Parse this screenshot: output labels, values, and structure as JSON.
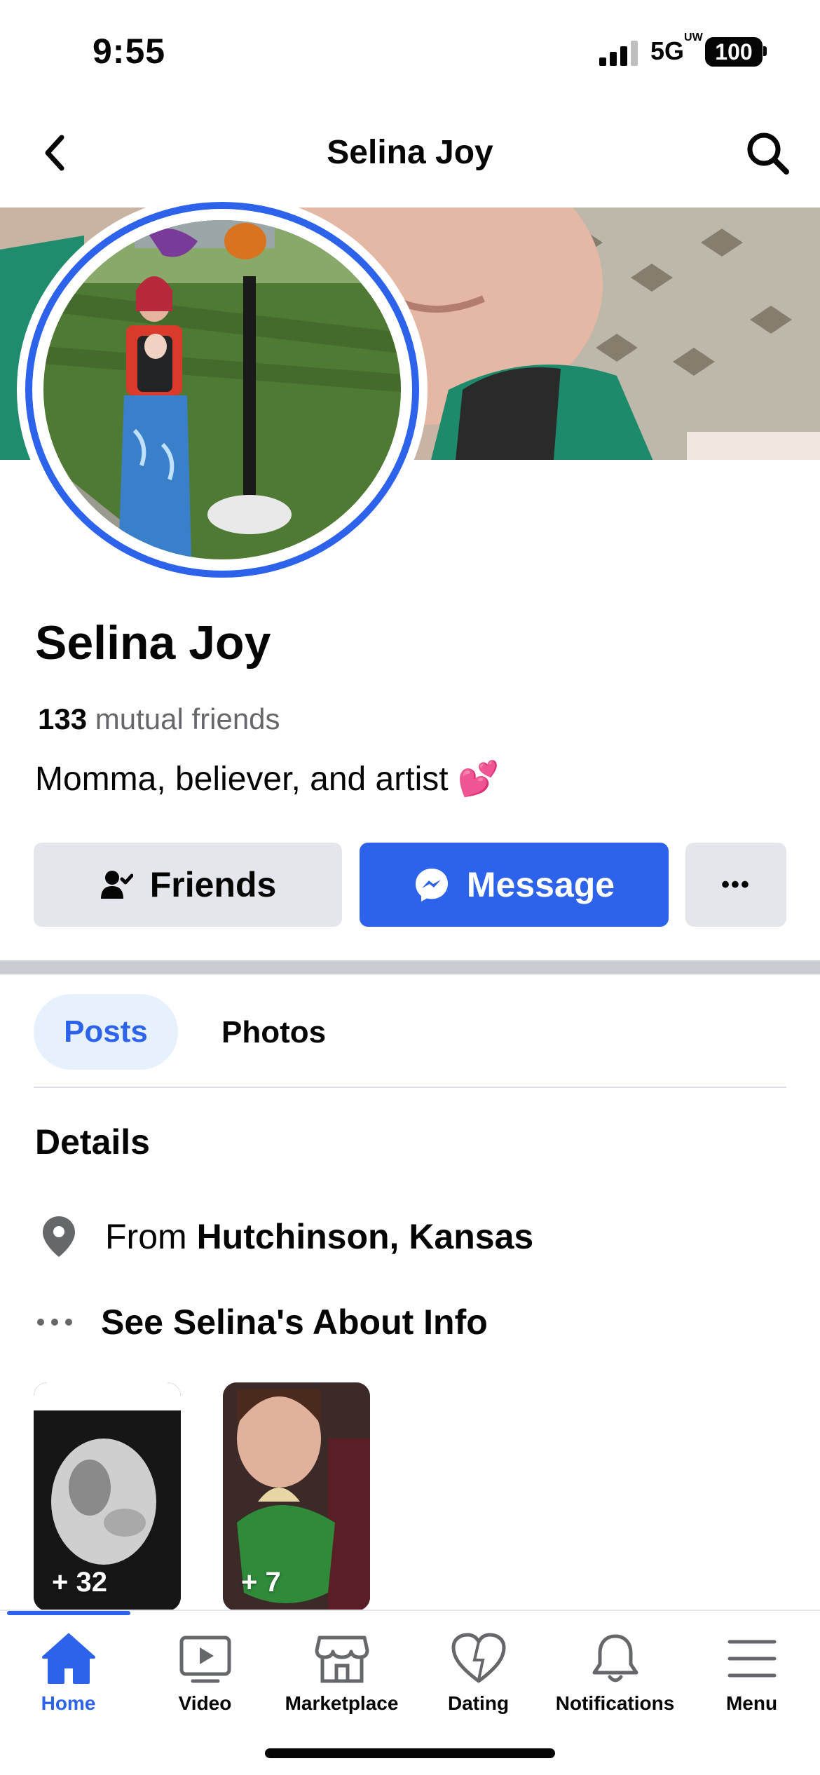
{
  "status_bar": {
    "time": "9:55",
    "network": "5G",
    "network_sup": "UW",
    "battery": "100"
  },
  "header": {
    "title": "Selina Joy"
  },
  "profile": {
    "name": "Selina Joy",
    "mutual_count": "133",
    "mutual_label": "mutual friends",
    "bio": "Momma, believer, and artist",
    "bio_emoji": "💕"
  },
  "actions": {
    "friends_label": "Friends",
    "message_label": "Message",
    "more_label": "•••"
  },
  "tabs": {
    "posts": "Posts",
    "photos": "Photos"
  },
  "details": {
    "title": "Details",
    "from_prefix": "From",
    "from_place": "Hutchinson, Kansas",
    "about_label": "See Selina's About Info"
  },
  "albums": [
    {
      "count": "+ 32"
    },
    {
      "count": "+ 7"
    }
  ],
  "bottom_nav": [
    {
      "label": "Home",
      "icon": "home-icon",
      "active": true
    },
    {
      "label": "Video",
      "icon": "video-icon"
    },
    {
      "label": "Marketplace",
      "icon": "marketplace-icon"
    },
    {
      "label": "Dating",
      "icon": "dating-icon"
    },
    {
      "label": "Notifications",
      "icon": "bell-icon"
    },
    {
      "label": "Menu",
      "icon": "menu-icon"
    }
  ],
  "colors": {
    "accent": "#2d63eb",
    "button_grey": "#e4e6eb",
    "tab_active_bg": "#e7f0fd",
    "secondary_text": "#65676b"
  }
}
